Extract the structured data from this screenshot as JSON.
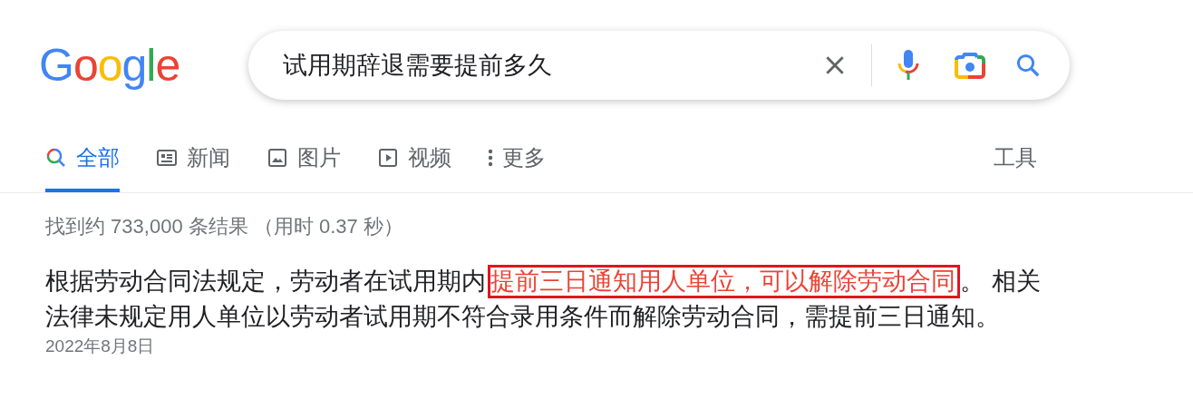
{
  "logo": {
    "text": "Google"
  },
  "search": {
    "value": "试用期辞退需要提前多久"
  },
  "tabs": [
    {
      "label": "全部",
      "kind": "all",
      "selected": true
    },
    {
      "label": "新闻",
      "kind": "news",
      "selected": false
    },
    {
      "label": "图片",
      "kind": "images",
      "selected": false
    },
    {
      "label": "视频",
      "kind": "videos",
      "selected": false
    },
    {
      "label": "更多",
      "kind": "more",
      "selected": false
    }
  ],
  "tools": "工具",
  "result_stats": "找到约 733,000 条结果 （用时 0.37 秒）",
  "snippet": {
    "segments": [
      {
        "kind": "plain",
        "text": "根据劳动合同法规定，劳动者在试用期内"
      },
      {
        "kind": "highlight",
        "text": "提前三日通知用人单位，可以解除劳动合同"
      },
      {
        "kind": "plain",
        "text": "。 相关法律未规定用人单位以劳动者试用期不符合录用条件而解除劳动合同，需提前三日通知。"
      }
    ],
    "date": "2022年8月8日"
  }
}
